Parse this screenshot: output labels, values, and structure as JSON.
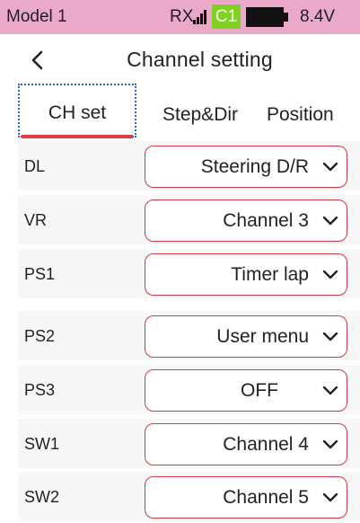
{
  "status_bar": {
    "model": "Model 1",
    "rx_label": "RX",
    "channel_badge": "C1",
    "voltage": "8.4V",
    "colors": {
      "background": "#eba9c9",
      "badge": "#7ed321"
    }
  },
  "header": {
    "title": "Channel setting",
    "back_icon": "chevron-left-icon"
  },
  "tabs": [
    {
      "label": "CH set",
      "active": true
    },
    {
      "label": "Step&Dir",
      "active": false
    },
    {
      "label": "Position",
      "active": false
    }
  ],
  "rows": [
    {
      "label": "DL",
      "value": "Steering D/R"
    },
    {
      "label": "VR",
      "value": "Channel 3"
    },
    {
      "label": "PS1",
      "value": "Timer lap"
    },
    {
      "label": "PS2",
      "value": "User menu"
    },
    {
      "label": "PS3",
      "value": "OFF"
    },
    {
      "label": "SW1",
      "value": "Channel 4"
    },
    {
      "label": "SW2",
      "value": "Channel 5"
    }
  ],
  "colors": {
    "accent": "#e43a46",
    "select_border": "#d23a45",
    "focus": "#2a67d6",
    "row_bg": "#f7f7f7"
  }
}
